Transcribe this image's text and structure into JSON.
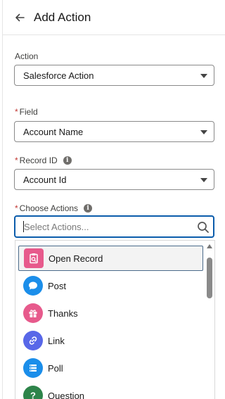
{
  "header": {
    "title": "Add Action"
  },
  "fields": {
    "action": {
      "label": "Action",
      "value": "Salesforce Action"
    },
    "field": {
      "required_mark": "*",
      "label": "Field",
      "value": "Account Name"
    },
    "record_id": {
      "required_mark": "*",
      "label": "Record ID",
      "info": "i",
      "value": "Account Id"
    },
    "choose_actions": {
      "required_mark": "*",
      "label": "Choose Actions",
      "info": "i",
      "placeholder": "Select Actions..."
    }
  },
  "actions": [
    {
      "label": "Open Record",
      "icon": "open-record-icon",
      "color": "#e75a8c",
      "selected": true
    },
    {
      "label": "Post",
      "icon": "post-icon",
      "color": "#1b8eea"
    },
    {
      "label": "Thanks",
      "icon": "thanks-icon",
      "color": "#e75a8c"
    },
    {
      "label": "Link",
      "icon": "link-icon",
      "color": "#5867e8"
    },
    {
      "label": "Poll",
      "icon": "poll-icon",
      "color": "#1b8eea"
    },
    {
      "label": "Question",
      "icon": "question-icon",
      "color": "#2e844a"
    }
  ]
}
